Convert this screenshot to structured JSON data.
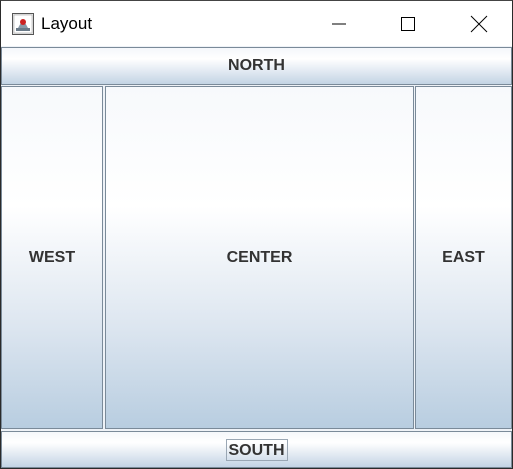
{
  "window": {
    "title": "Layout",
    "icon": "java-app-icon",
    "controls": {
      "minimize": "minimize-icon",
      "maximize": "maximize-icon",
      "close": "close-icon"
    }
  },
  "buttons": {
    "north": "NORTH",
    "west": "WEST",
    "center": "CENTER",
    "east": "EAST",
    "south": "SOUTH"
  },
  "colors": {
    "button_text": "#333333",
    "button_border": "#7a8a99",
    "gradient_bottom": "#b8cde0"
  }
}
